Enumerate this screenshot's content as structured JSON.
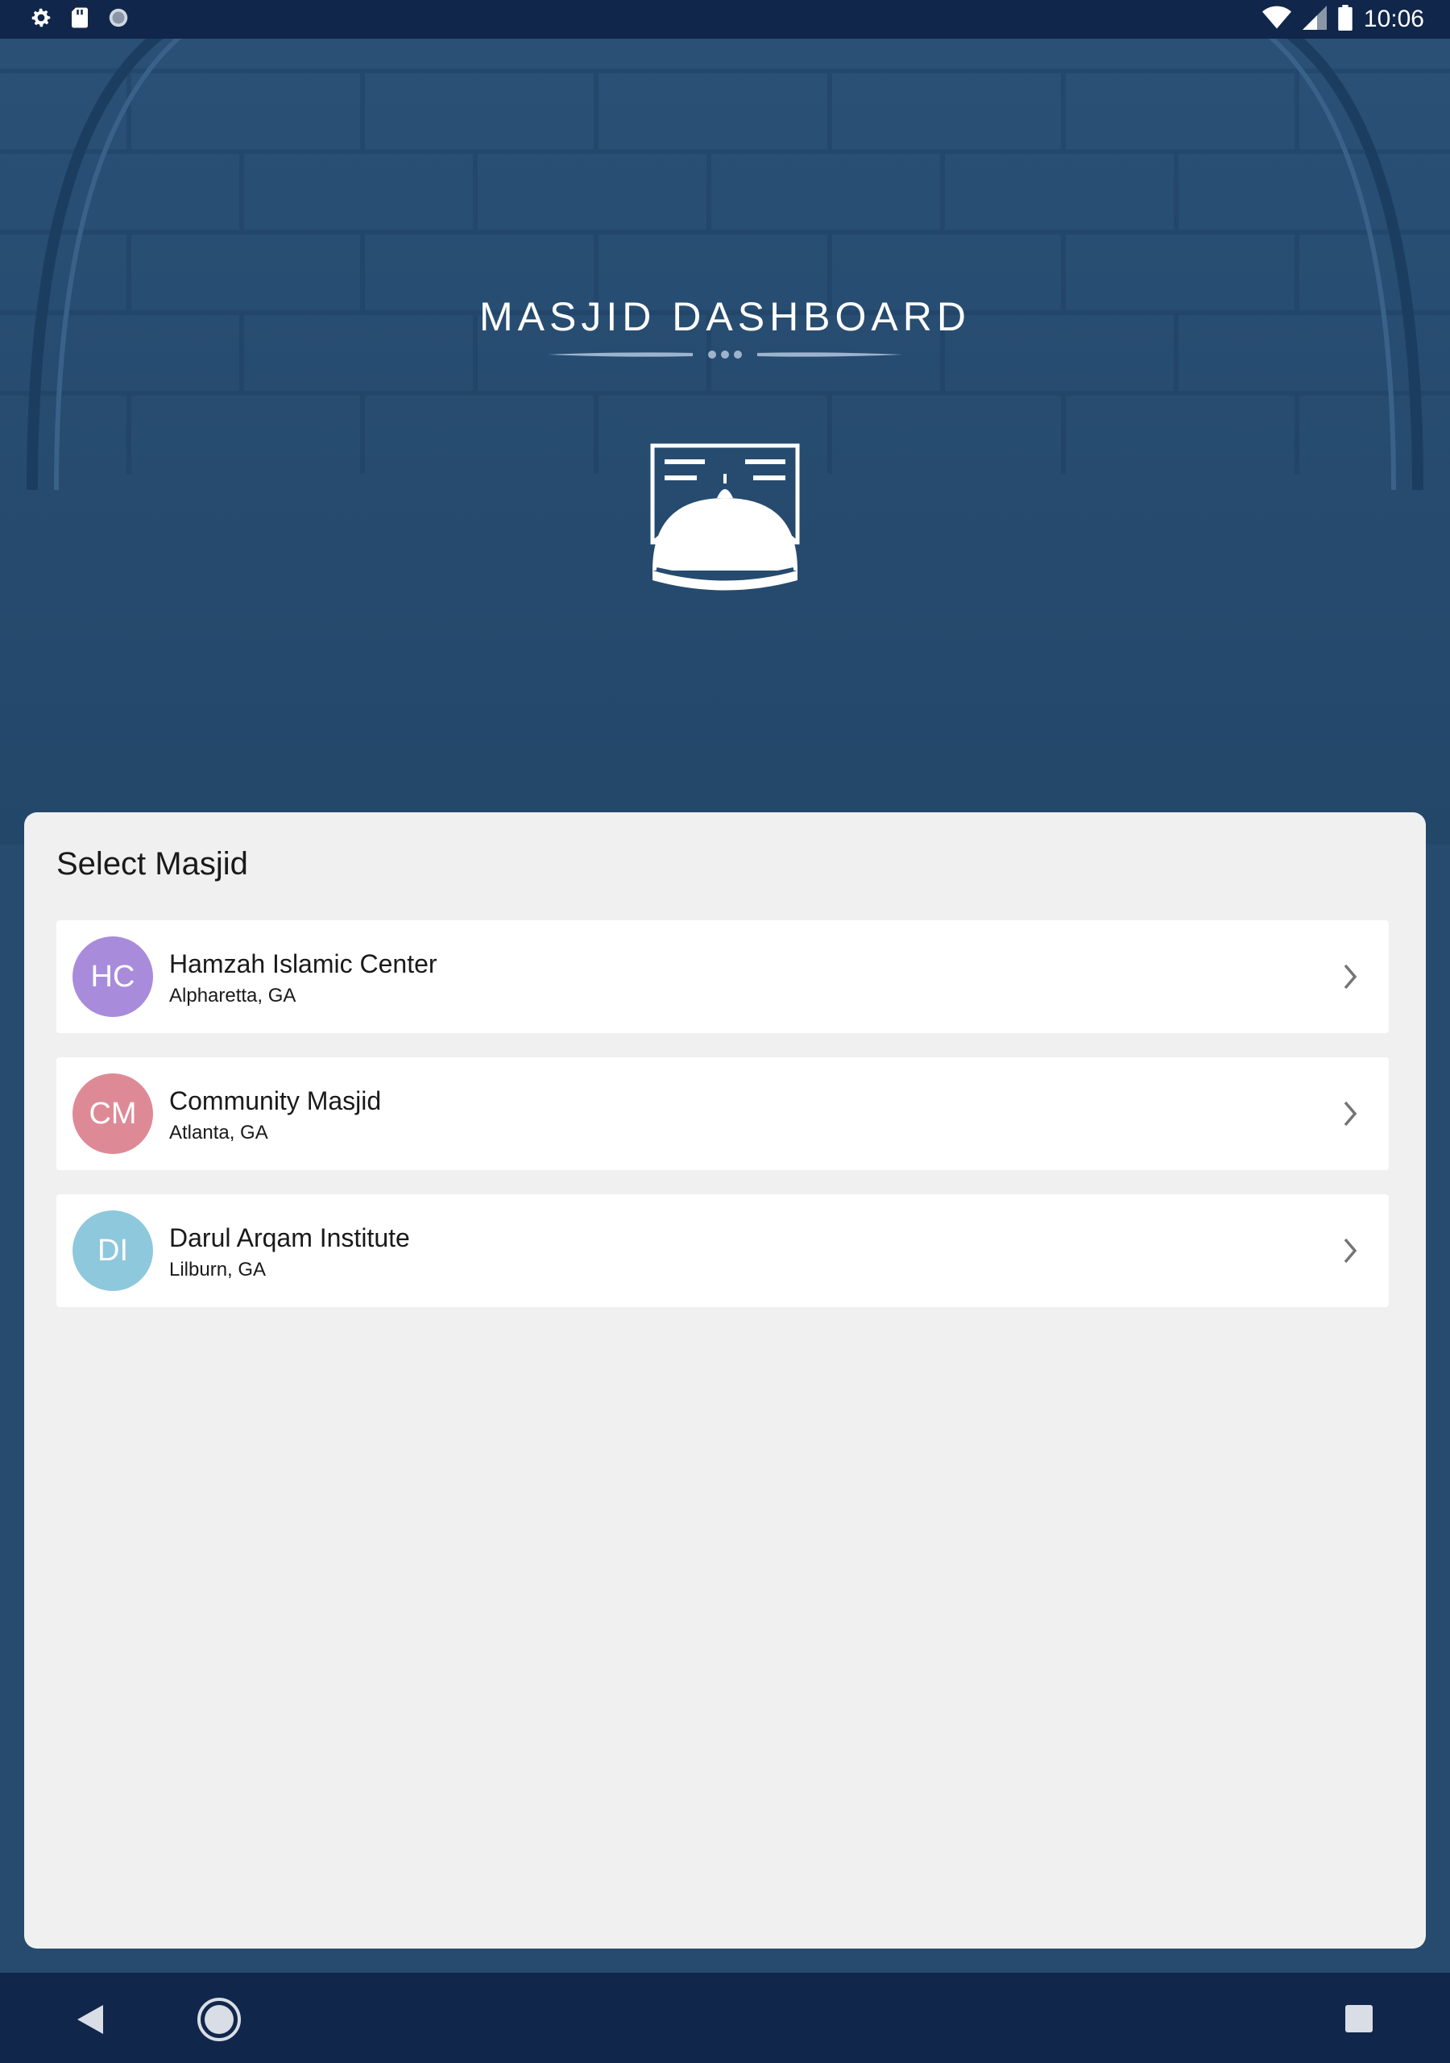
{
  "status_bar": {
    "time": "10:06",
    "left_icons": [
      "settings-icon",
      "sd-card-icon",
      "sync-circle-icon"
    ],
    "right_icons": [
      "wifi-icon",
      "cell-signal-icon",
      "battery-icon"
    ]
  },
  "header": {
    "app_title": "MASJID DASHBOARD",
    "logo_icon": "masjid-dome-icon"
  },
  "card": {
    "title": "Select Masjid",
    "items": [
      {
        "initials": "HC",
        "name": "Hamzah Islamic Center",
        "location": "Alpharetta, GA",
        "color": "#a98bdb"
      },
      {
        "initials": "CM",
        "name": "Community Masjid",
        "location": "Atlanta, GA",
        "color": "#de8a96"
      },
      {
        "initials": "DI",
        "name": "Darul Arqam Institute",
        "location": "Lilburn, GA",
        "color": "#8ec8dc"
      }
    ]
  },
  "nav_bar": {
    "icons": [
      "back-icon",
      "home-icon",
      "recents-icon"
    ]
  },
  "colors": {
    "status_bar_bg": "#10264a",
    "header_bg": "#264b6e",
    "card_bg": "#f0f0f0",
    "nav_bar_bg": "#10264a"
  }
}
